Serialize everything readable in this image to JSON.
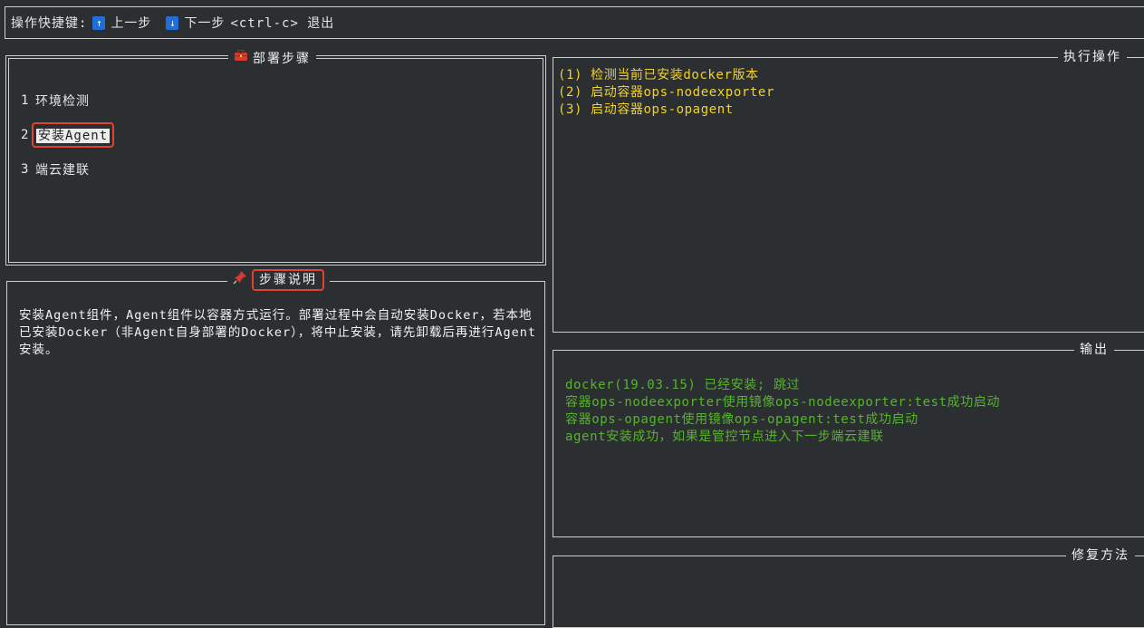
{
  "shortcut_bar": {
    "label": "操作快捷键:",
    "up_icon": "↑",
    "up_label": "上一步",
    "down_icon": "↓",
    "down_label": "下一步",
    "exit_label": "<ctrl-c> 退出"
  },
  "steps_panel": {
    "title_icon": "toolbox-icon",
    "title": "部署步骤",
    "items": [
      {
        "num": "1",
        "label": "环境检测"
      },
      {
        "num": "2",
        "label": "安装Agent",
        "selected": true
      },
      {
        "num": "3",
        "label": "端云建联"
      }
    ]
  },
  "desc_panel": {
    "title_icon": "pushpin-icon",
    "title": "步骤说明",
    "text": "安装Agent组件，Agent组件以容器方式运行。部署过程中会自动安装Docker，若本地已安装Docker（非Agent自身部署的Docker），将中止安装，请先卸载后再进行Agent安装。"
  },
  "exec_panel": {
    "title": "执行操作",
    "lines": [
      "(1) 检测当前已安装docker版本",
      "(2) 启动容器ops-nodeexporter",
      "(3) 启动容器ops-opagent"
    ]
  },
  "output_panel": {
    "title": "输出",
    "lines": [
      "docker(19.03.15) 已经安装; 跳过",
      "容器ops-nodeexporter使用镜像ops-nodeexporter:test成功启动",
      "容器ops-opagent使用镜像ops-opagent:test成功启动",
      "agent安装成功，如果是管控节点进入下一步端云建联"
    ]
  },
  "fix_panel": {
    "title": "修复方法"
  },
  "colors": {
    "background": "#2b2f31",
    "exec_text": "#f2d22c",
    "output_text": "#56b42c",
    "highlight_border": "#e0432f"
  }
}
